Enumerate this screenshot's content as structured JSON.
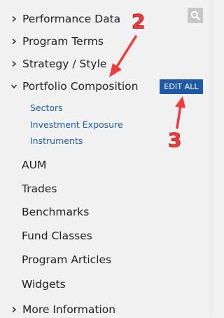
{
  "search": {
    "icon": "search-icon"
  },
  "menu": {
    "performance_data": "Performance Data",
    "program_terms": "Program Terms",
    "strategy_style": "Strategy / Style",
    "portfolio_composition": "Portfolio Composition",
    "more_information": "More Information"
  },
  "portfolio_subitems": {
    "sectors": "Sectors",
    "investment_exposure": "Investment Exposure",
    "instruments": "Instruments"
  },
  "other_items": {
    "aum": "AUM",
    "trades": "Trades",
    "benchmarks": "Benchmarks",
    "fund_classes": "Fund Classes",
    "program_articles": "Program Articles",
    "widgets": "Widgets"
  },
  "actions": {
    "edit_all": "EDIT ALL"
  },
  "annotations": {
    "marker_2": "2",
    "marker_3": "3"
  },
  "colors": {
    "background": "#f1f1f1",
    "link": "#1f5ea8",
    "button": "#1f5aa6",
    "annotation": "#f23d3d"
  }
}
